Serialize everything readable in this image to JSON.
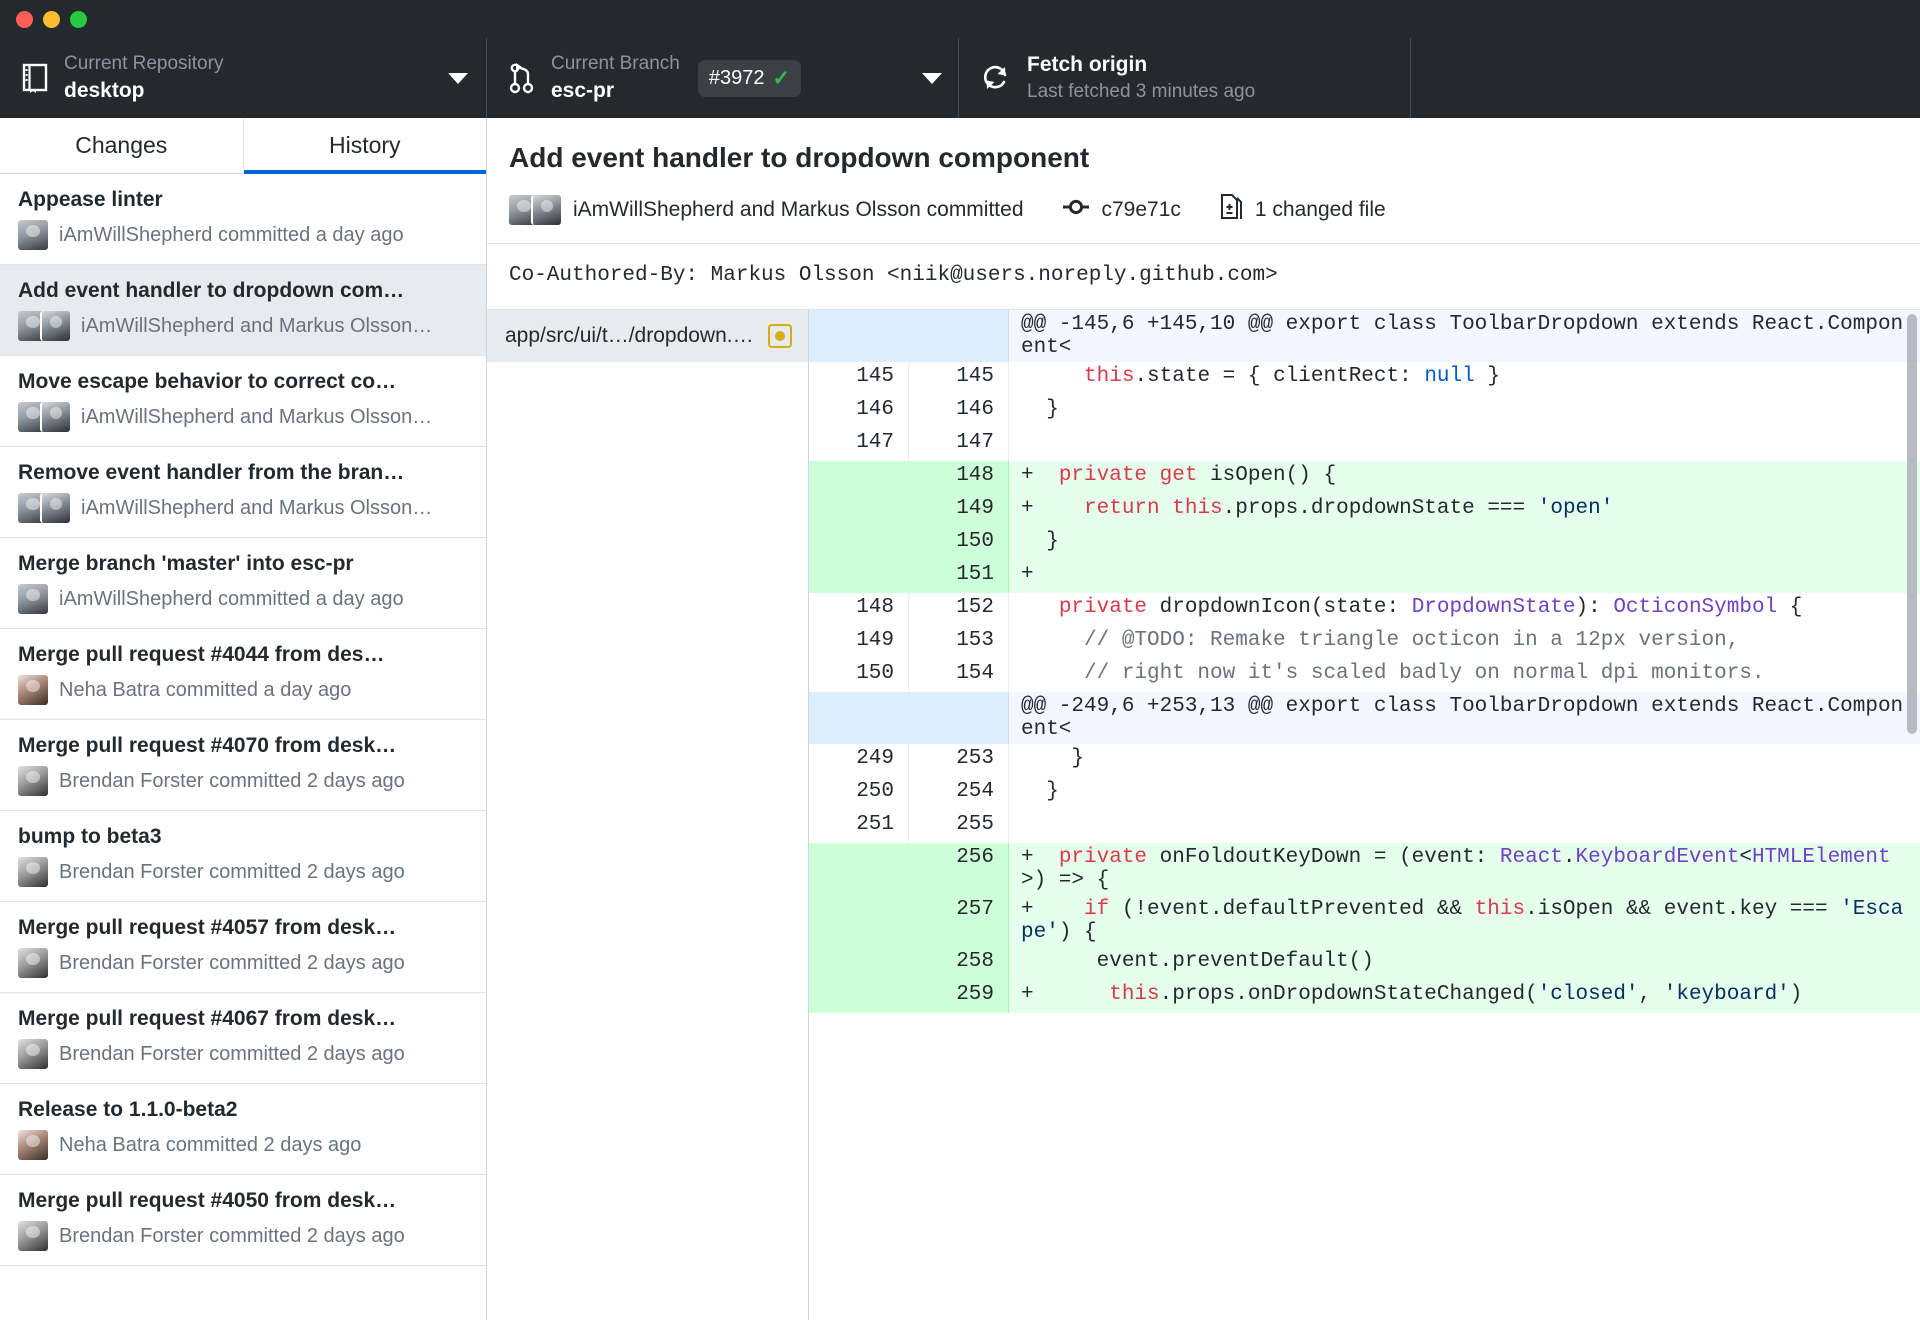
{
  "window": {
    "traffic_lights": [
      "close",
      "minimize",
      "maximize"
    ]
  },
  "toolbar": {
    "repository": {
      "label": "Current Repository",
      "value": "desktop",
      "icon": "repo-icon",
      "caret": "chevron-down-icon"
    },
    "branch": {
      "label": "Current Branch",
      "value": "esc-pr",
      "icon": "branch-icon",
      "pr_badge": "#3972",
      "pr_check": "✓",
      "caret": "chevron-down-icon"
    },
    "fetch": {
      "title": "Fetch origin",
      "subtitle": "Last fetched 3 minutes ago",
      "icon": "sync-icon"
    }
  },
  "sidebar": {
    "tabs": [
      {
        "label": "Changes",
        "active": false
      },
      {
        "label": "History",
        "active": true
      }
    ],
    "commits": [
      {
        "summary": "Appease linter",
        "byline": "iAmWillShepherd committed a day ago",
        "avatars": 1,
        "selected": false
      },
      {
        "summary": "Add event handler to dropdown com…",
        "byline": "iAmWillShepherd and Markus Olsson…",
        "avatars": 2,
        "selected": true
      },
      {
        "summary": "Move escape behavior to correct co…",
        "byline": "iAmWillShepherd and Markus Olsson…",
        "avatars": 2,
        "selected": false
      },
      {
        "summary": "Remove event handler from the bran…",
        "byline": "iAmWillShepherd and Markus Olsson…",
        "avatars": 2,
        "selected": false
      },
      {
        "summary": "Merge branch 'master' into esc-pr",
        "byline": "iAmWillShepherd committed a day ago",
        "avatars": 1,
        "selected": false
      },
      {
        "summary": "Merge pull request #4044 from des…",
        "byline": "Neha Batra committed a day ago",
        "avatars": 1,
        "selected": false
      },
      {
        "summary": "Merge pull request #4070 from desk…",
        "byline": "Brendan Forster committed 2 days ago",
        "avatars": 1,
        "selected": false
      },
      {
        "summary": "bump to beta3",
        "byline": "Brendan Forster committed 2 days ago",
        "avatars": 1,
        "selected": false
      },
      {
        "summary": "Merge pull request #4057 from desk…",
        "byline": "Brendan Forster committed 2 days ago",
        "avatars": 1,
        "selected": false
      },
      {
        "summary": "Merge pull request #4067 from desk…",
        "byline": "Brendan Forster committed 2 days ago",
        "avatars": 1,
        "selected": false
      },
      {
        "summary": "Release to 1.1.0-beta2",
        "byline": "Neha Batra committed 2 days ago",
        "avatars": 1,
        "selected": false
      },
      {
        "summary": "Merge pull request #4050 from desk…",
        "byline": "Brendan Forster committed 2 days ago",
        "avatars": 1,
        "selected": false
      }
    ]
  },
  "commit_detail": {
    "title": "Add event handler to dropdown component",
    "author_line": "iAmWillShepherd and Markus Olsson committed",
    "sha": "c79e71c",
    "changed_files": "1 changed file",
    "description": "Co-Authored-By: Markus Olsson <niik@users.noreply.github.com>",
    "file": {
      "path": "app/src/ui/t…/dropdown.tsx",
      "status": "modified"
    }
  },
  "diff": {
    "rows": [
      {
        "type": "hunk",
        "old": "",
        "new": "",
        "sign": "",
        "text": "@@ -145,6 +145,10 @@ export class ToolbarDropdown extends React.Component<"
      },
      {
        "type": "ctx",
        "old": "145",
        "new": "145",
        "sign": " ",
        "text": "    this.state = { clientRect: null }"
      },
      {
        "type": "ctx",
        "old": "146",
        "new": "146",
        "sign": " ",
        "text": "  }"
      },
      {
        "type": "ctx",
        "old": "147",
        "new": "147",
        "sign": " ",
        "text": ""
      },
      {
        "type": "add",
        "old": "",
        "new": "148",
        "sign": "+",
        "text": "  private get isOpen() {"
      },
      {
        "type": "add",
        "old": "",
        "new": "149",
        "sign": "+",
        "text": "    return this.props.dropdownState === 'open'"
      },
      {
        "type": "add",
        "old": "",
        "new": "150",
        "sign": "+",
        "text": "  }"
      },
      {
        "type": "add",
        "old": "",
        "new": "151",
        "sign": "+",
        "text": ""
      },
      {
        "type": "ctx",
        "old": "148",
        "new": "152",
        "sign": " ",
        "text": "  private dropdownIcon(state: DropdownState): OcticonSymbol {"
      },
      {
        "type": "ctx",
        "old": "149",
        "new": "153",
        "sign": " ",
        "text": "    // @TODO: Remake triangle octicon in a 12px version,"
      },
      {
        "type": "ctx",
        "old": "150",
        "new": "154",
        "sign": " ",
        "text": "    // right now it's scaled badly on normal dpi monitors."
      },
      {
        "type": "hunk",
        "old": "",
        "new": "",
        "sign": "",
        "text": "@@ -249,6 +253,13 @@ export class ToolbarDropdown extends React.Component<"
      },
      {
        "type": "ctx",
        "old": "249",
        "new": "253",
        "sign": " ",
        "text": "    }"
      },
      {
        "type": "ctx",
        "old": "250",
        "new": "254",
        "sign": " ",
        "text": "  }"
      },
      {
        "type": "ctx",
        "old": "251",
        "new": "255",
        "sign": " ",
        "text": ""
      },
      {
        "type": "add",
        "old": "",
        "new": "256",
        "sign": "+",
        "text": "  private onFoldoutKeyDown = (event: React.KeyboardEvent<HTMLElement>) => {"
      },
      {
        "type": "add",
        "old": "",
        "new": "257",
        "sign": "+",
        "text": "    if (!event.defaultPrevented && this.isOpen && event.key === 'Escape') {"
      },
      {
        "type": "add",
        "old": "",
        "new": "258",
        "sign": "+",
        "text": "      event.preventDefault()"
      },
      {
        "type": "add",
        "old": "",
        "new": "259",
        "sign": "+",
        "text": "      this.props.onDropdownStateChanged('closed', 'keyboard')"
      }
    ]
  },
  "colors": {
    "toolbar_bg": "#24292e",
    "accent": "#0366d6",
    "add_bg": "#e6ffed",
    "hunk_bg": "#f1f8ff",
    "selected_bg": "#e6ebf1",
    "modified": "#dbab09",
    "check_green": "#2cbe4e"
  }
}
